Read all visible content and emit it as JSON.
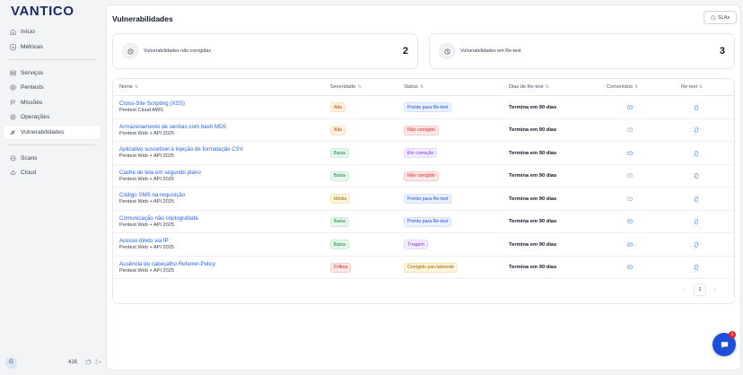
{
  "brand": {
    "logo": "VANTICO"
  },
  "sidebar": {
    "group1": [
      {
        "label": "Início",
        "icon": "home-icon"
      },
      {
        "label": "Métricas",
        "icon": "chart-icon"
      }
    ],
    "group2": [
      {
        "label": "Serviços",
        "icon": "server-icon"
      },
      {
        "label": "Pentests",
        "icon": "target-icon"
      },
      {
        "label": "Missões",
        "icon": "flag-icon"
      },
      {
        "label": "Operações",
        "icon": "gear-icon"
      },
      {
        "label": "Vulnerabilidades",
        "icon": "bug-icon",
        "active": true
      }
    ],
    "group3": [
      {
        "label": "Scans",
        "icon": "scan-icon"
      },
      {
        "label": "Cloud",
        "icon": "cloud-icon"
      }
    ]
  },
  "user": {
    "initial": "G",
    "count": "416"
  },
  "header": {
    "title": "Vulnerabilidades",
    "sla_label": "SLAs"
  },
  "stats": [
    {
      "label": "Vulnerabilidades não corrigidas",
      "value": "2"
    },
    {
      "label": "Vulnerabilidades em Re-test",
      "value": "3"
    }
  ],
  "table": {
    "columns": {
      "name": "Nome",
      "severity": "Severidade",
      "status": "Status",
      "days": "Dias de Re-test",
      "comment": "Comentário",
      "retest": "Re-test"
    },
    "rows": [
      {
        "name": "Cross-Site Scripting (XSS)",
        "project": "Pentest Cloud AWS",
        "severity": "Alta",
        "sev_class": "sev-alta",
        "status": "Pronto para Re-test",
        "status_class": "st-blue",
        "days": "Termina em 90 dias",
        "comment_active": true
      },
      {
        "name": "Armazenamento de senhas com hash MD5",
        "project": "Pentest Web + API 2025",
        "severity": "Alta",
        "sev_class": "sev-alta",
        "status": "Não corrigido",
        "status_class": "st-red",
        "days": "Termina em 90 dias",
        "comment_active": false
      },
      {
        "name": "Aplicativo suscetível à injeção de formatação CSV",
        "project": "Pentest Web + API 2025",
        "severity": "Baixa",
        "sev_class": "sev-baixa",
        "status": "Em correção",
        "status_class": "st-purple",
        "days": "Termina em 90 dias",
        "comment_active": true
      },
      {
        "name": "Cache de tela em segundo plano",
        "project": "Pentest Web + API 2025",
        "severity": "Baixa",
        "sev_class": "sev-baixa",
        "status": "Não corrigido",
        "status_class": "st-red",
        "days": "Termina em 90 dias",
        "comment_active": false
      },
      {
        "name": "Código SMS na requisição",
        "project": "Pentest Web + API 2025",
        "severity": "Média",
        "sev_class": "sev-media",
        "status": "Pronto para Re-test",
        "status_class": "st-blue",
        "days": "Termina em 90 dias",
        "comment_active": false
      },
      {
        "name": "Comunicação não criptografada",
        "project": "Pentest Web + API 2025",
        "severity": "Baixa",
        "sev_class": "sev-baixa",
        "status": "Pronto para Re-test",
        "status_class": "st-blue",
        "days": "Termina em 90 dias",
        "comment_active": true
      },
      {
        "name": "Acesso direto via IP",
        "project": "Pentest Web + API 2025",
        "severity": "Baixa",
        "sev_class": "sev-baixa",
        "status": "Triagem",
        "status_class": "st-purple",
        "days": "Termina em 90 dias",
        "comment_active": true
      },
      {
        "name": "Ausência do cabeçalho Referrer-Policy",
        "project": "Pentest Web + API 2025",
        "severity": "Crítica",
        "sev_class": "sev-critica",
        "status": "Corrigido parcialmente",
        "status_class": "st-amber",
        "days": "Termina em 90 dias",
        "comment_active": true
      }
    ]
  },
  "pagination": {
    "current": "1",
    "prev": "‹",
    "next": "›"
  },
  "chat": {
    "badge": "1"
  },
  "colors": {
    "accent": "#2563eb",
    "brand": "#1e2a6b",
    "chat": "#1d4ed8"
  }
}
